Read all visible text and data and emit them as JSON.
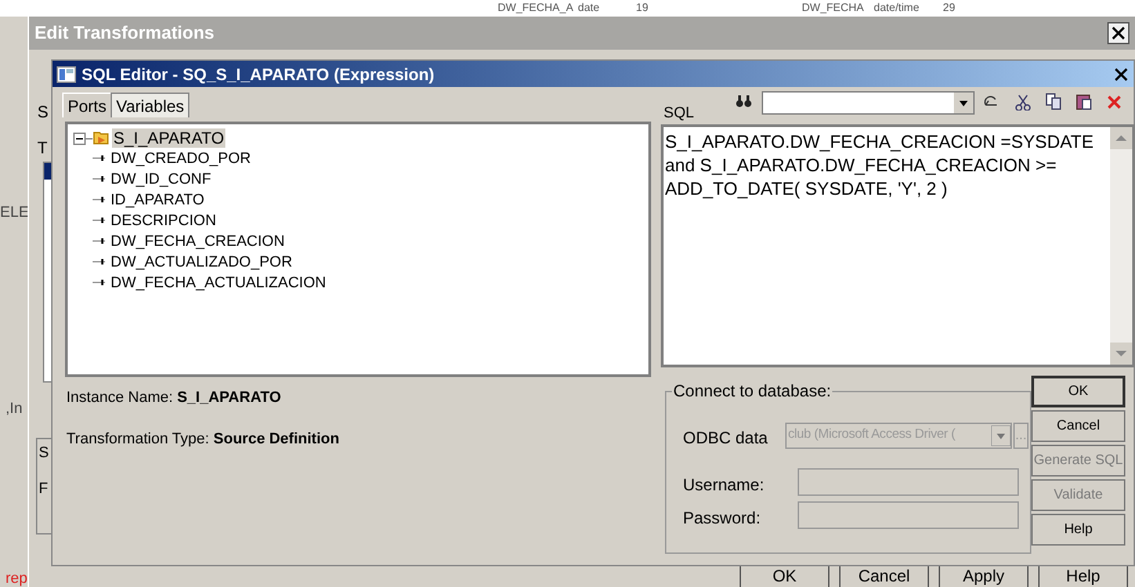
{
  "background": {
    "cells": [
      {
        "text": "DW_FECHA_A"
      },
      {
        "text": "date"
      },
      {
        "text": "19"
      },
      {
        "text": "DW_FECHA"
      },
      {
        "text": "date/time"
      },
      {
        "text": "29"
      }
    ],
    "fragments": [
      "ELE",
      ",In",
      "rep"
    ]
  },
  "edit_transformations": {
    "title": "Edit Transformations",
    "side_letters": [
      "S",
      "T"
    ],
    "lower_fragments": [
      "S",
      "F"
    ],
    "buttons": [
      {
        "label": "OK",
        "disabled": false
      },
      {
        "label": "Cancel",
        "disabled": false
      },
      {
        "label": "Apply",
        "disabled": false
      },
      {
        "label": "Help",
        "disabled": false
      }
    ]
  },
  "sql_editor": {
    "title": "SQL Editor - SQ_S_I_APARATO (Expression)",
    "tabs": [
      {
        "label": "Ports",
        "selected": true
      },
      {
        "label": "Variables",
        "selected": false
      }
    ],
    "tree": [
      {
        "label": "S_I_APARATO",
        "expanded": true,
        "selected": true,
        "children": [
          {
            "label": "DW_CREADO_POR"
          },
          {
            "label": "DW_ID_CONF"
          },
          {
            "label": "ID_APARATO"
          },
          {
            "label": "DESCRIPCION"
          },
          {
            "label": "DW_FECHA_CREACION"
          },
          {
            "label": "DW_ACTUALIZADO_POR"
          },
          {
            "label": "DW_FECHA_ACTUALIZACION"
          }
        ]
      }
    ],
    "instance_name_label": "Instance Name:",
    "instance_name": "S_I_APARATO",
    "transformation_type_label": "Transformation Type:",
    "transformation_type": "Source Definition",
    "sql_label": "SQL",
    "sql_text": "S_I_APARATO.DW_FECHA_CREACION =SYSDATE and S_I_APARATO.DW_FECHA_CREACION >= ADD_TO_DATE( SYSDATE, 'Y', 2 )",
    "connect": {
      "legend": "Connect to database:",
      "odbc_label": "ODBC data",
      "odbc_value": "club (Microsoft Access Driver (",
      "odbc_disabled": true,
      "browse_label": "...",
      "username_label": "Username:",
      "password_label": "Password:"
    },
    "buttons": [
      {
        "label": "OK",
        "disabled": false,
        "default": true
      },
      {
        "label": "Cancel",
        "disabled": false,
        "default": false
      },
      {
        "label": "Generate SQL",
        "disabled": true,
        "default": false
      },
      {
        "label": "Validate",
        "disabled": true,
        "default": false
      },
      {
        "label": "Help",
        "disabled": false,
        "default": false
      }
    ]
  }
}
